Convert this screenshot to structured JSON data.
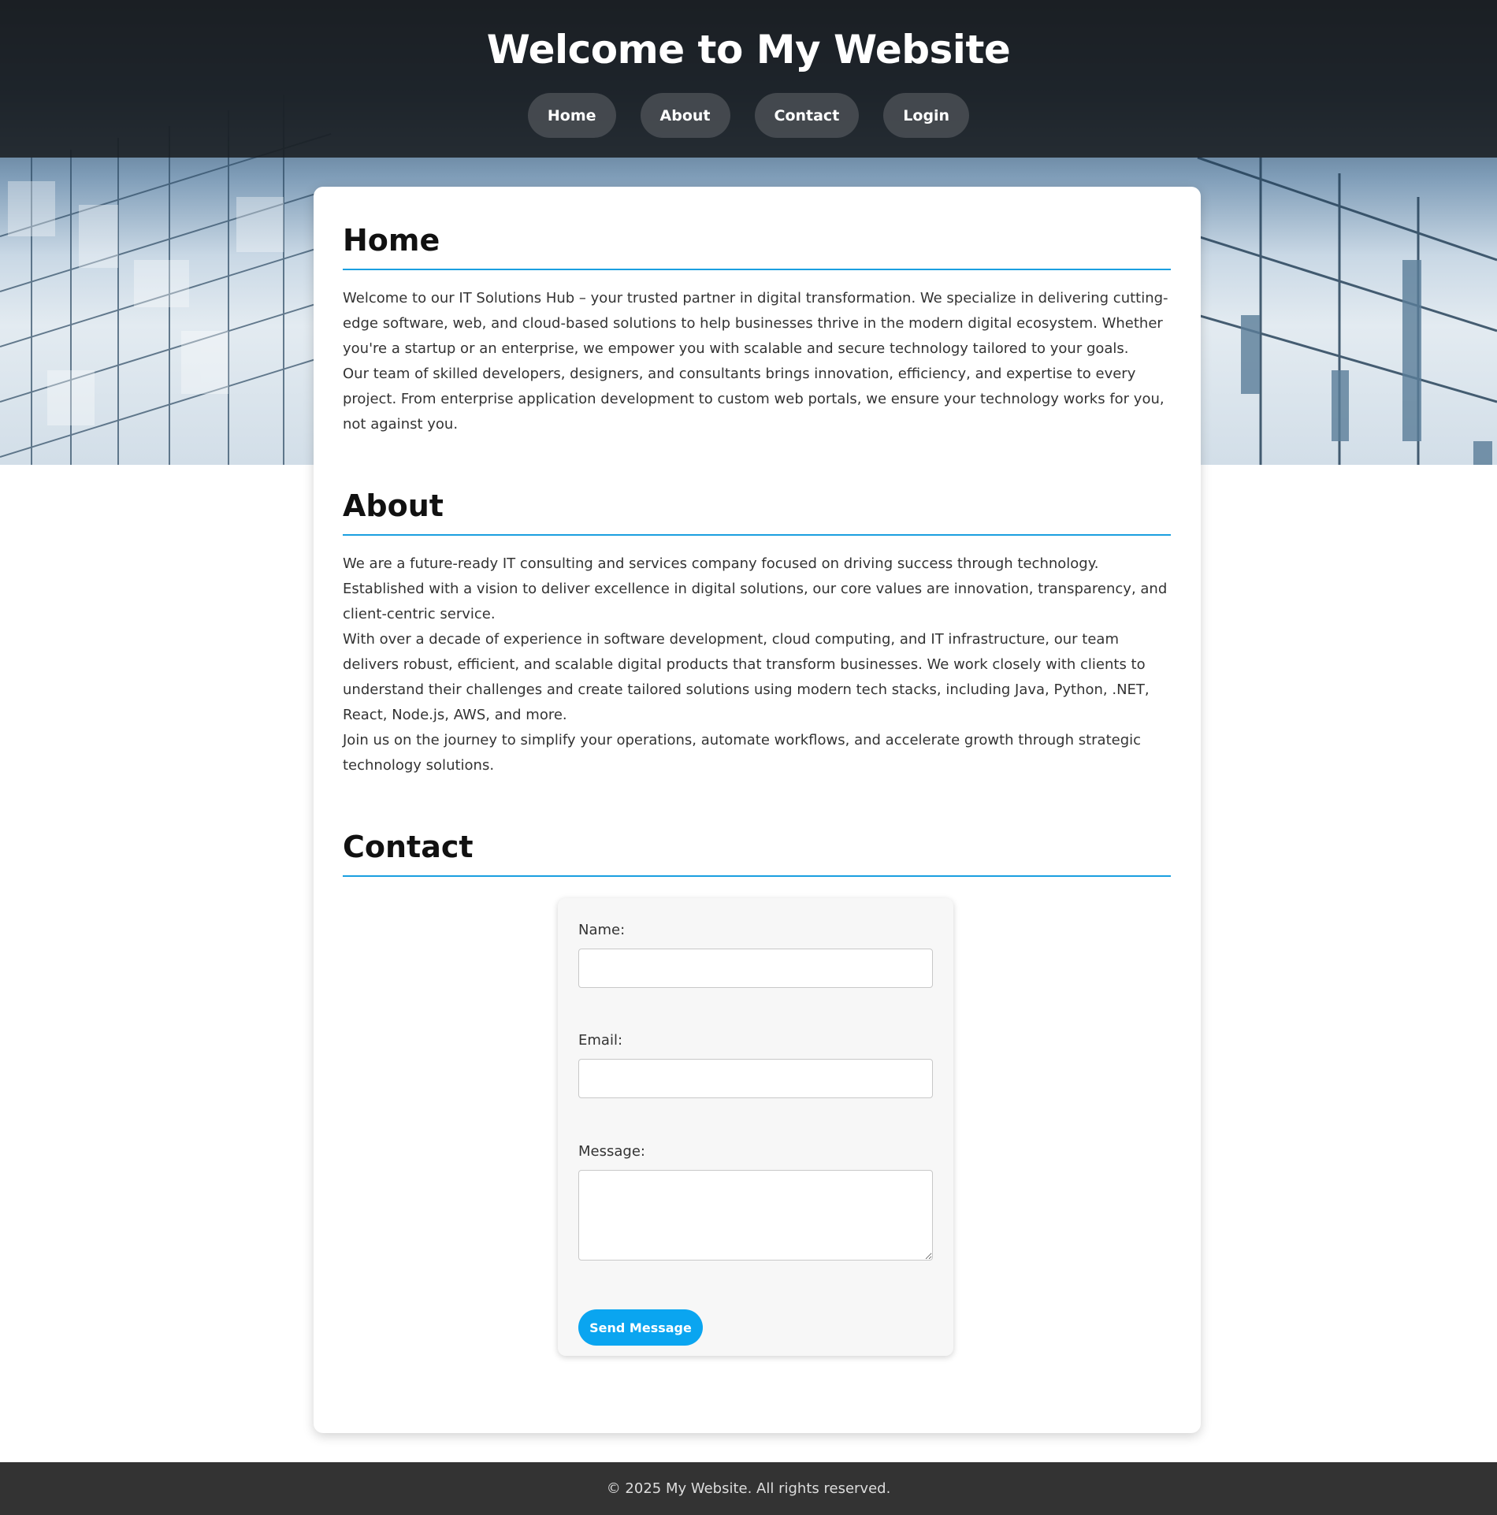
{
  "header": {
    "title": "Welcome to My Website",
    "nav": [
      {
        "label": "Home"
      },
      {
        "label": "About"
      },
      {
        "label": "Contact"
      },
      {
        "label": "Login"
      }
    ]
  },
  "sections": {
    "home": {
      "heading": "Home",
      "paragraphs": [
        "Welcome to our IT Solutions Hub – your trusted partner in digital transformation. We specialize in delivering cutting-edge software, web, and cloud-based solutions to help businesses thrive in the modern digital ecosystem. Whether you're a startup or an enterprise, we empower you with scalable and secure technology tailored to your goals.",
        "Our team of skilled developers, designers, and consultants brings innovation, efficiency, and expertise to every project. From enterprise application development to custom web portals, we ensure your technology works for you, not against you."
      ]
    },
    "about": {
      "heading": "About",
      "paragraphs": [
        "We are a future-ready IT consulting and services company focused on driving success through technology. Established with a vision to deliver excellence in digital solutions, our core values are innovation, transparency, and client-centric service.",
        "With over a decade of experience in software development, cloud computing, and IT infrastructure, our team delivers robust, efficient, and scalable digital products that transform businesses. We work closely with clients to understand their challenges and create tailored solutions using modern tech stacks, including Java, Python, .NET, React, Node.js, AWS, and more.",
        "Join us on the journey to simplify your operations, automate workflows, and accelerate growth through strategic technology solutions."
      ]
    },
    "contact": {
      "heading": "Contact",
      "form": {
        "name_label": "Name:",
        "name_value": "",
        "email_label": "Email:",
        "email_value": "",
        "message_label": "Message:",
        "message_value": "",
        "submit_label": "Send Message"
      }
    }
  },
  "footer": {
    "text": "© 2025 My Website. All rights reserved."
  },
  "colors": {
    "accent": "#1a9fe0",
    "button": "#0aa5f0",
    "header_bg": "#191c20",
    "footer_bg": "#333333"
  }
}
